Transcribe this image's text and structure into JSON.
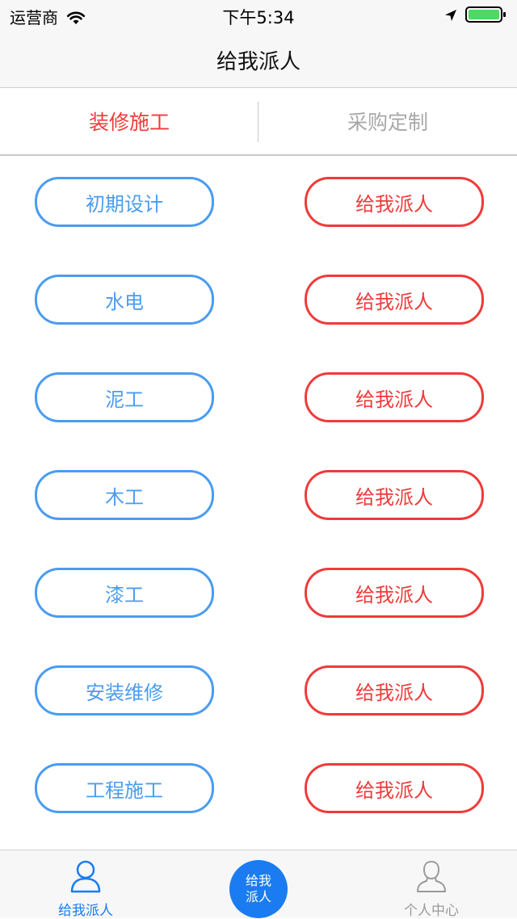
{
  "status_bar": {
    "carrier": "运营商",
    "time": "下午5:34"
  },
  "nav": {
    "title": "给我派人"
  },
  "tabs": [
    {
      "label": "装修施工",
      "active": true
    },
    {
      "label": "采购定制",
      "active": false
    }
  ],
  "rows": [
    {
      "category": "初期设计",
      "action": "给我派人"
    },
    {
      "category": "水电",
      "action": "给我派人"
    },
    {
      "category": "泥工",
      "action": "给我派人"
    },
    {
      "category": "木工",
      "action": "给我派人"
    },
    {
      "category": "漆工",
      "action": "给我派人"
    },
    {
      "category": "安装维修",
      "action": "给我派人"
    },
    {
      "category": "工程施工",
      "action": "给我派人"
    }
  ],
  "tabbar": {
    "left": {
      "label": "给我派人",
      "icon": "user-icon"
    },
    "center": {
      "label": "给我\n派人"
    },
    "right": {
      "label": "个人中心",
      "icon": "profile-icon"
    }
  },
  "colors": {
    "accent_red": "#f03a3a",
    "accent_blue": "#4a9cf0",
    "tab_inactive": "#a8a8a8",
    "tabbar_blue": "#1a7cf0",
    "tabbar_inactive": "#9a9a9a",
    "battery_green": "#4cd964"
  }
}
